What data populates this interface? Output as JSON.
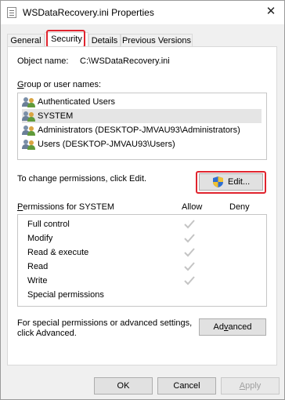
{
  "window": {
    "title": "WSDataRecovery.ini Properties",
    "close_glyph": "✕"
  },
  "tabs": [
    {
      "label": "General"
    },
    {
      "label": "Security"
    },
    {
      "label": "Details"
    },
    {
      "label": "Previous Versions"
    }
  ],
  "object": {
    "label": "Object name:",
    "value": "C:\\WSDataRecovery.ini"
  },
  "groups": {
    "label": "Group or user names:",
    "items": [
      {
        "label": "Authenticated Users"
      },
      {
        "label": "SYSTEM"
      },
      {
        "label": "Administrators (DESKTOP-JMVAU93\\Administrators)"
      },
      {
        "label": "Users (DESKTOP-JMVAU93\\Users)"
      }
    ],
    "selected_index": 1
  },
  "change_hint": "To change permissions, click Edit.",
  "edit_button": "Edit...",
  "permissions": {
    "header": "Permissions for SYSTEM",
    "allow_label": "Allow",
    "deny_label": "Deny",
    "rows": [
      {
        "name": "Full control",
        "allow": true,
        "deny": false
      },
      {
        "name": "Modify",
        "allow": true,
        "deny": false
      },
      {
        "name": "Read & execute",
        "allow": true,
        "deny": false
      },
      {
        "name": "Read",
        "allow": true,
        "deny": false
      },
      {
        "name": "Write",
        "allow": true,
        "deny": false
      },
      {
        "name": "Special permissions",
        "allow": false,
        "deny": false
      }
    ]
  },
  "advanced": {
    "text_line1": "For special permissions or advanced settings,",
    "text_line2": "click Advanced.",
    "button": "Advanced"
  },
  "footer": {
    "ok": "OK",
    "cancel": "Cancel",
    "apply": "Apply"
  },
  "colors": {
    "highlight": "#e0242e",
    "check": "#c4c4c4",
    "selected_row": "#e5e5e5"
  }
}
